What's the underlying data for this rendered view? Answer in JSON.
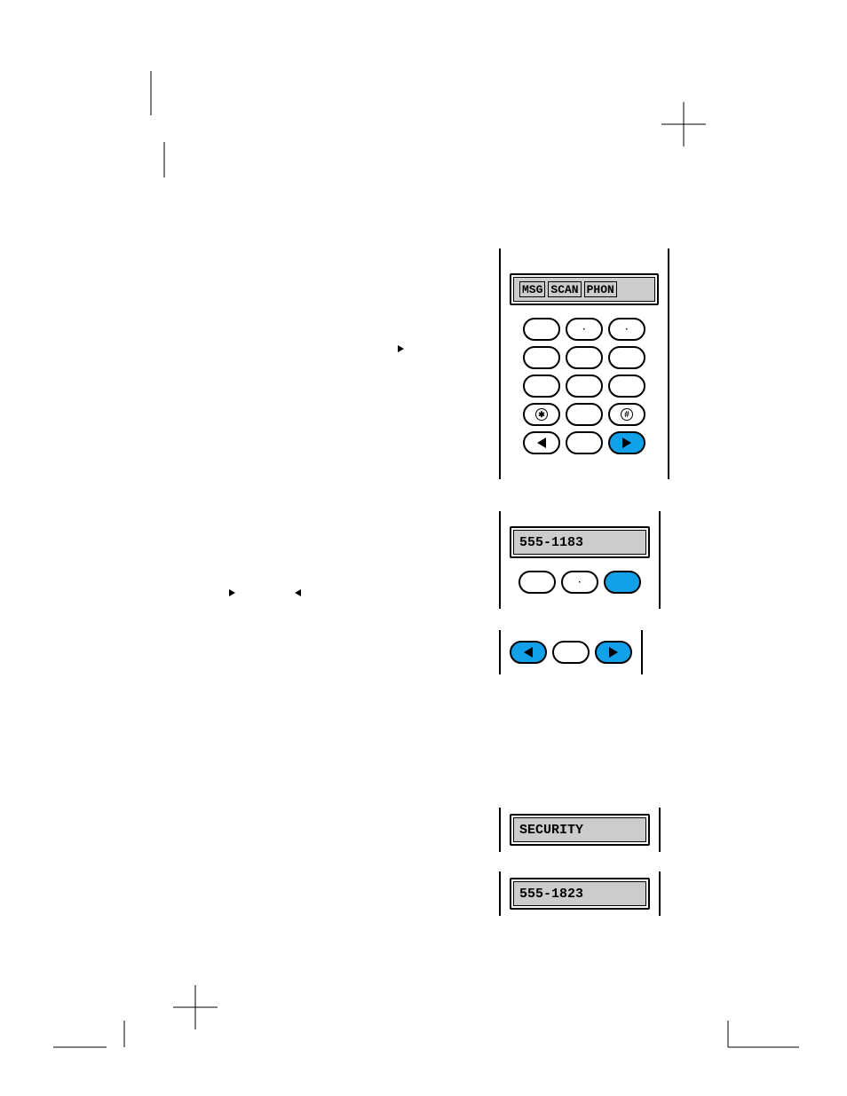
{
  "displays": {
    "top": {
      "tab1": "MSG",
      "tab2": "SCAN",
      "tab3": "PHON"
    },
    "second": "555-1183",
    "third": "SECURITY",
    "fourth": "555-1823"
  },
  "keypad": {
    "row1": [
      "",
      "·",
      "·"
    ],
    "row2": [
      "",
      "",
      ""
    ],
    "row3": [
      "",
      "",
      ""
    ],
    "star": "✱",
    "pound": "#"
  }
}
